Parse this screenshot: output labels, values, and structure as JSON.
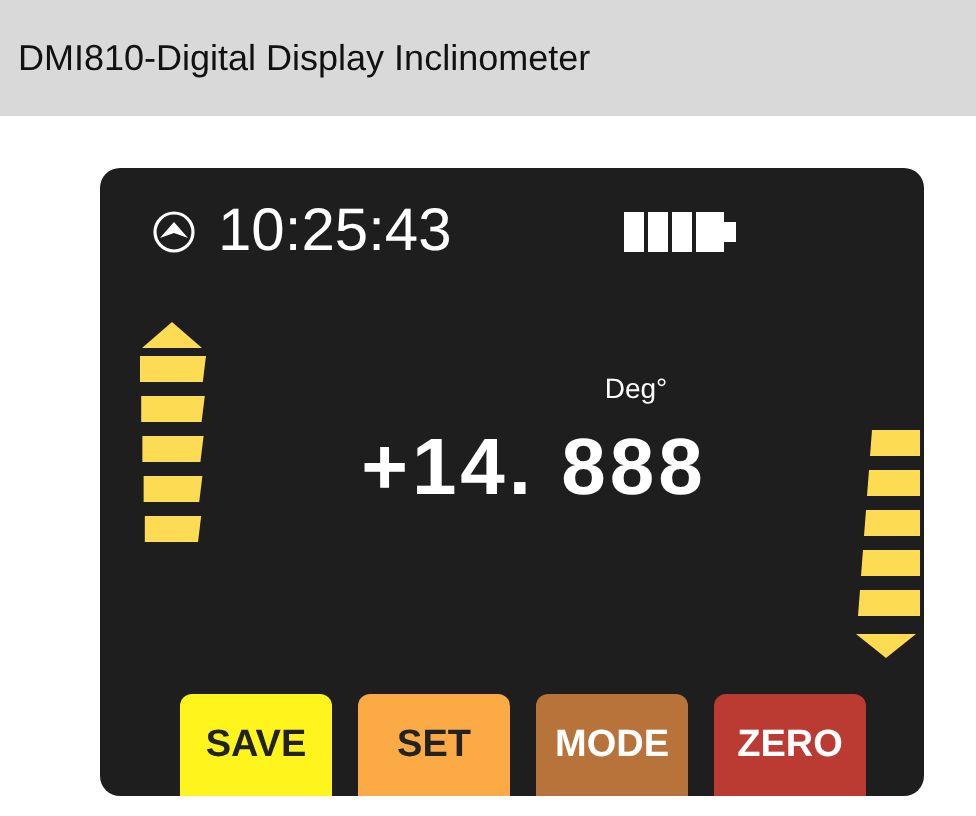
{
  "header": {
    "title": "DMI810-Digital Display Inclinometer"
  },
  "display": {
    "time": "10:25:43",
    "unit": "Deg°",
    "reading": "+14. 888"
  },
  "buttons": [
    {
      "label": "SAVE",
      "color": "#fff51c"
    },
    {
      "label": "SET",
      "color": "#fcaa45"
    },
    {
      "label": "MODE",
      "color": "#b8733a"
    },
    {
      "label": "ZERO",
      "color": "#bb3b32"
    }
  ]
}
